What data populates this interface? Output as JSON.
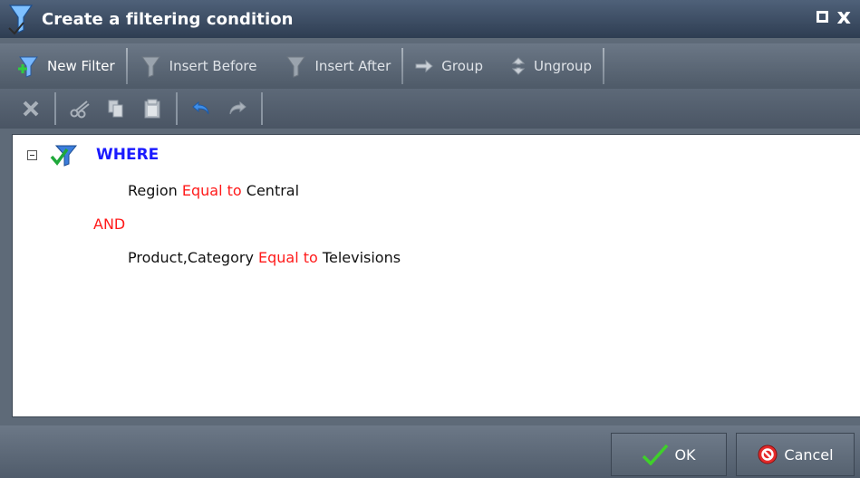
{
  "window": {
    "title": "Create a filtering condition",
    "title_icon": "filter-funnel-icon",
    "maximize_icon": "maximize-icon",
    "close_glyph": "x"
  },
  "toolbar": {
    "new_filter": "New Filter",
    "insert_before": "Insert Before",
    "insert_after": "Insert After",
    "group": "Group",
    "ungroup": "Ungroup"
  },
  "edit_toolbar": {
    "icons": [
      "delete-icon",
      "cut-icon",
      "copy-icon",
      "paste-icon",
      "undo-icon",
      "redo-icon"
    ]
  },
  "condition": {
    "root_label": "WHERE",
    "rows": [
      {
        "field": "Region",
        "operator": "Equal to",
        "value": "Central"
      },
      {
        "field": "Product,Category",
        "operator": "Equal to",
        "value": "Televisions"
      }
    ],
    "join": "AND"
  },
  "footer": {
    "ok": "OK",
    "cancel": "Cancel"
  },
  "colors": {
    "where": "#1a1aff",
    "operator": "#ff1a1a",
    "title_bar": "#2e3d52"
  }
}
